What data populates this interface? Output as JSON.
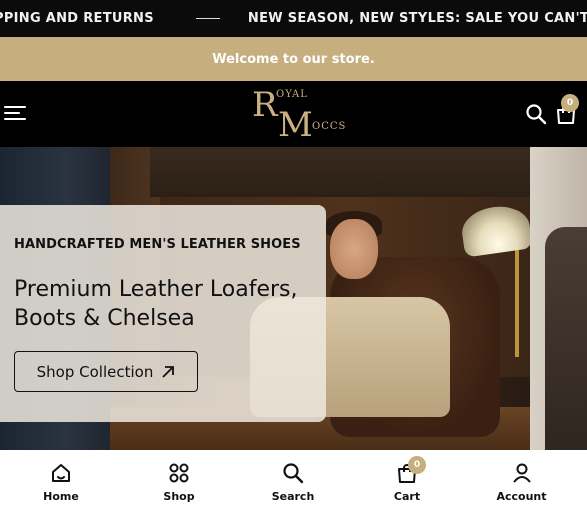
{
  "marquee": {
    "items": [
      "PPING AND RETURNS",
      "NEW SEASON, NEW STYLES: SALE YOU CAN'T MISS"
    ]
  },
  "announcement": {
    "text": "Welcome to our store."
  },
  "header": {
    "logo": {
      "letter_r": "R",
      "letter_m": "M",
      "word_oyal": "OYAL",
      "word_occs": "OCCS"
    },
    "cart_count": "0",
    "icons": {
      "menu": "menu-icon",
      "search": "search-icon",
      "cart": "cart-icon"
    }
  },
  "hero": {
    "eyebrow": "HANDCRAFTED MEN'S LEATHER SHOES",
    "headline_line1": "Premium Leather Loafers,",
    "headline_line2": "Boots & Chelsea",
    "cta_label": "Shop Collection"
  },
  "bottom_nav": {
    "items": [
      {
        "label": "Home",
        "icon": "home-icon"
      },
      {
        "label": "Shop",
        "icon": "grid-icon"
      },
      {
        "label": "Search",
        "icon": "search-icon"
      },
      {
        "label": "Cart",
        "icon": "cart-icon"
      },
      {
        "label": "Account",
        "icon": "user-icon"
      }
    ],
    "cart_count": "0"
  },
  "colors": {
    "accent": "#c6ae7e",
    "dark": "#000000",
    "card": "#eee8de"
  }
}
